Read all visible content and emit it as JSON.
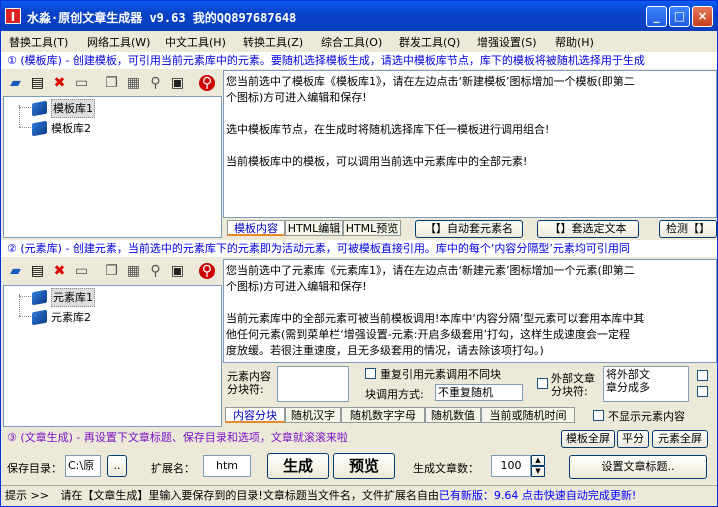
{
  "window": {
    "icon_letter": "I",
    "title": "水淼·原创文章生成器 v9.63   我的QQ897687648"
  },
  "menu": [
    "替换工具(T)",
    "网络工具(W)",
    "中文工具(H)",
    "转换工具(Z)",
    "综合工具(O)",
    "群发工具(Q)",
    "增强设置(S)",
    "帮助(H)"
  ],
  "section1": {
    "heading": "① (模板库) - 创建模板，可引用当前元素库中的元素。要随机选择模板生成，请选中模板库节点，库下的模板将被随机选择用于生成",
    "tree": [
      "模板库1",
      "模板库2"
    ],
    "content": [
      "您当前选中了模板库《模板库1》，请在左边点击‘新建模板’图标增加一个模板(即第二",
      "个图标)方可进入编辑和保存!",
      "",
      "选中模板库节点，在生成时将随机选择库下任一模板进行调用组合!",
      "",
      "当前模板库中的模板，可以调用当前选中元素库中的全部元素!"
    ],
    "tabs": [
      "模板内容",
      "HTML编辑",
      "HTML预览"
    ],
    "buttons": {
      "auto_apply": "【】自动套元素名",
      "apply_selected": "【】套选定文本",
      "detect": "检测【】"
    }
  },
  "section2": {
    "heading": "② (元素库) - 创建元素，当前选中的元素库下的元素即为活动元素，可被模板直接引用。库中的每个‘内容分隔型’元素均可引用同",
    "tree": [
      "元素库1",
      "元素库2"
    ],
    "content": [
      "您当前选中了元素库《元素库1》，请在左边点击‘新建元素’图标增加一个元素(即第二",
      "个图标)方可进入编辑和保存!",
      "",
      "当前元素库中的全部元素可被当前模板调用!本库中‘内容分隔’型元素可以套用本库中其",
      "他任何元素(需到菜单栏‘增强设置-元素:开启多级套用’打勾，这样生成速度会一定程",
      "度放缓。若很注重速度，且无多级套用的情况，请去除该项打勾。)"
    ],
    "options": {
      "content_splitter_label": "元素内容\n分块符:",
      "repeat_label": "重复引用元素调用不同块",
      "external_label": "外部文章\n分块符:",
      "external_value": "将外部文\n章分成多",
      "call_mode_label": "块调用方式:",
      "call_mode_value": "不重复随机"
    },
    "tabs": [
      "内容分块",
      "随机汉字",
      "随机数字字母",
      "随机数值",
      "当前或随机时间"
    ],
    "hide_content_label": "不显示元素内容"
  },
  "section3": {
    "heading": "③ (文章生成) - 再设置下文章标题、保存目录和选项，文章就滚滚来啦",
    "buttons": {
      "template_fullscreen": "模板全屏",
      "split_screen": "平分",
      "element_fullscreen": "元素全屏",
      "generate": "生成",
      "preview": "预览",
      "set_title": "设置文章标题.."
    },
    "save_dir_label": "保存目录：",
    "save_dir_value": "C:\\原",
    "browse_label": "..",
    "ext_label": "扩展名：",
    "ext_value": "htm",
    "count_label": "生成文章数：",
    "count_value": "100"
  },
  "status": {
    "prefix": "提示 >>",
    "text": "请在【文章生成】里输入要保存到的目录!文章标题当文件名，文件扩展名自由",
    "update_text": "已有新版：9.64 点击快速自动完成更新!"
  },
  "colors": {
    "titlebar": "#0842c8",
    "heading_text": "#0000e0",
    "update_text": "#0000ff"
  }
}
